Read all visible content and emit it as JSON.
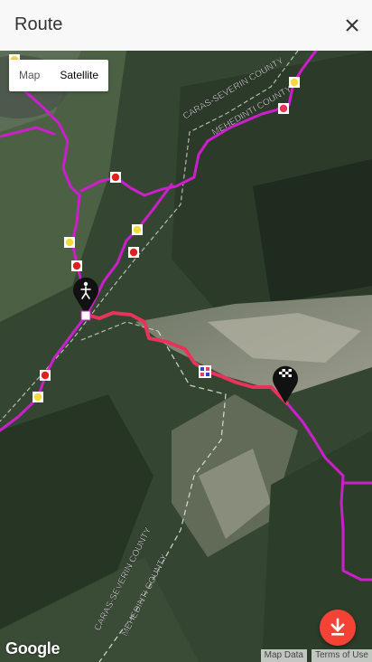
{
  "header": {
    "title": "Route"
  },
  "map": {
    "type_control": {
      "map_label": "Map",
      "satellite_label": "Satellite",
      "selected": "Satellite"
    },
    "labels": {
      "county_a_top": "CARAS-SEVERIN COUNTY",
      "county_b_top": "MEHEDINTI COUNTY",
      "county_a_bottom": "CARAS-SEVERIN COUNTY",
      "county_b_bottom": "MEHEDINTI COUNTY"
    },
    "start_marker_icon": "hiker-icon",
    "finish_marker_icon": "checkered-flag-icon",
    "colors": {
      "trail": "#cc1fcc",
      "route": "#e8335a",
      "marker_yellow": "#f2dc3c",
      "marker_red": "#e02020"
    }
  },
  "footer": {
    "google_logo": "Google",
    "map_data": "Map Data",
    "terms": "Terms of Use"
  },
  "download_button": {
    "icon": "download-icon"
  }
}
